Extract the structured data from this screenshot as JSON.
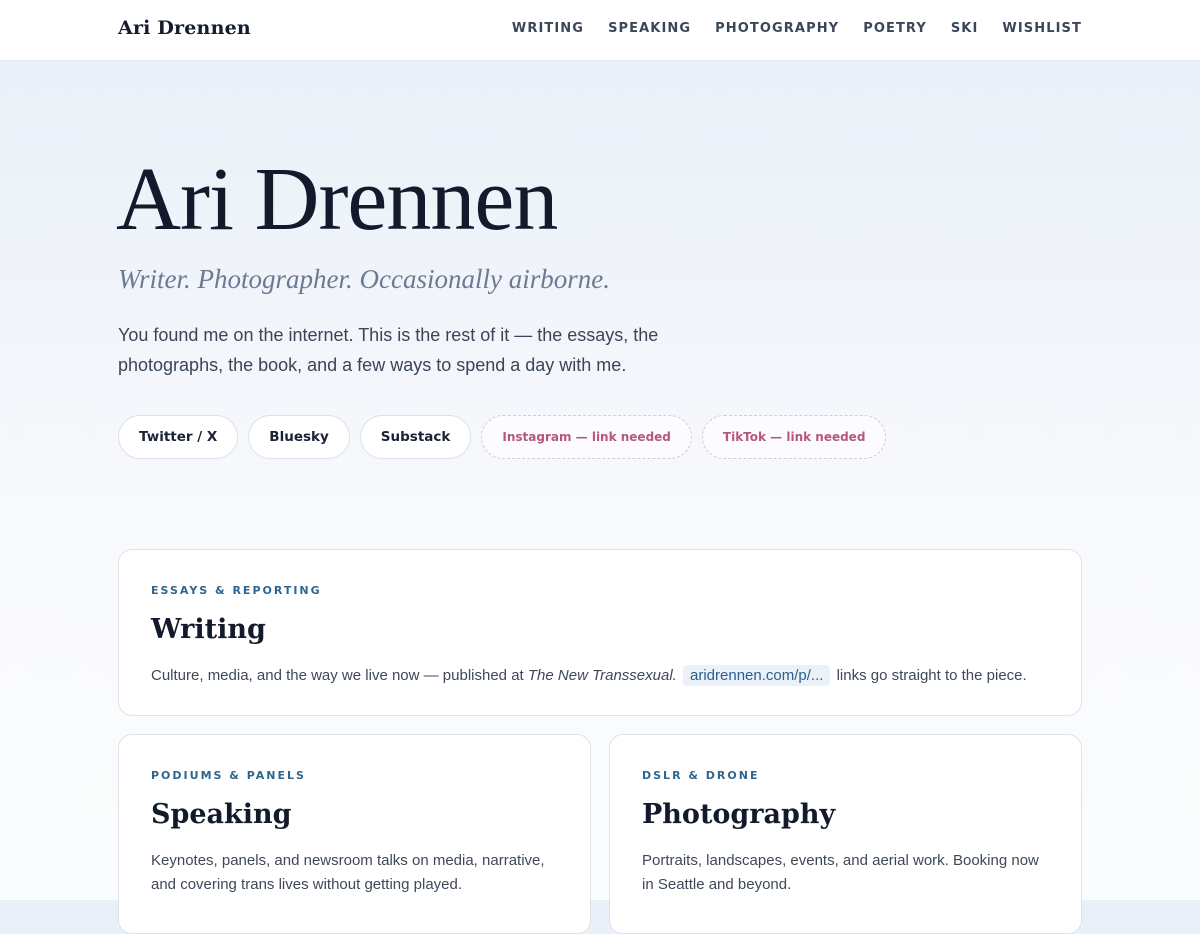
{
  "header": {
    "brand": "Ari Drennen",
    "nav": [
      "WRITING",
      "SPEAKING",
      "PHOTOGRAPHY",
      "POETRY",
      "SKI",
      "WISHLIST"
    ]
  },
  "hero": {
    "title": "Ari Drennen",
    "tagline": "Writer. Photographer. Occasionally airborne.",
    "intro": "You found me on the internet. This is the rest of it — the essays, the photographs, the book, and a few ways to spend a day with me.",
    "socials": [
      "Twitter / X",
      "Bluesky",
      "Substack"
    ],
    "pending_socials": [
      "Instagram — link needed",
      "TikTok — link needed"
    ]
  },
  "cards": {
    "writing": {
      "eyebrow": "ESSAYS & REPORTING",
      "title": "Writing",
      "body_pre": "Culture, media, and the way we live now — published at ",
      "publication": "The New Transsexual.",
      "link_chip": "aridrennen.com/p/...",
      "body_post": " links go straight to the piece."
    },
    "speaking": {
      "eyebrow": "PODIUMS & PANELS",
      "title": "Speaking",
      "body": "Keynotes, panels, and newsroom talks on media, narrative, and covering trans lives without getting played."
    },
    "photography": {
      "eyebrow": "DSLR & DRONE",
      "title": "Photography",
      "body": "Portraits, landscapes, events, and aerial work. Booking now in Seattle and beyond."
    }
  }
}
